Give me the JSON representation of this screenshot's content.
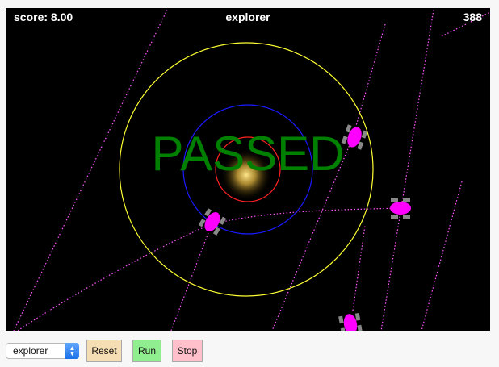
{
  "hud": {
    "score": "score: 8.00",
    "name": "explorer",
    "counter": "388"
  },
  "status_text": "PASSED",
  "controls": {
    "selected_program": "explorer",
    "reset_label": "Reset",
    "run_label": "Run",
    "stop_label": "Stop"
  },
  "colors": {
    "background": "#000000",
    "outer_ring": "#ffff33",
    "middle_ring": "#1a1aff",
    "inner_ring": "#ff2222",
    "passed_text": "#008000",
    "robot_body": "#ff00ff",
    "trail": "#ff55ff",
    "reset_button": "#f5deb3",
    "run_button": "#90ee90",
    "stop_button": "#ffc0cb"
  },
  "icons": {
    "robot": "robot-icon",
    "dropdown_arrow": "chevron-updown-icon"
  }
}
